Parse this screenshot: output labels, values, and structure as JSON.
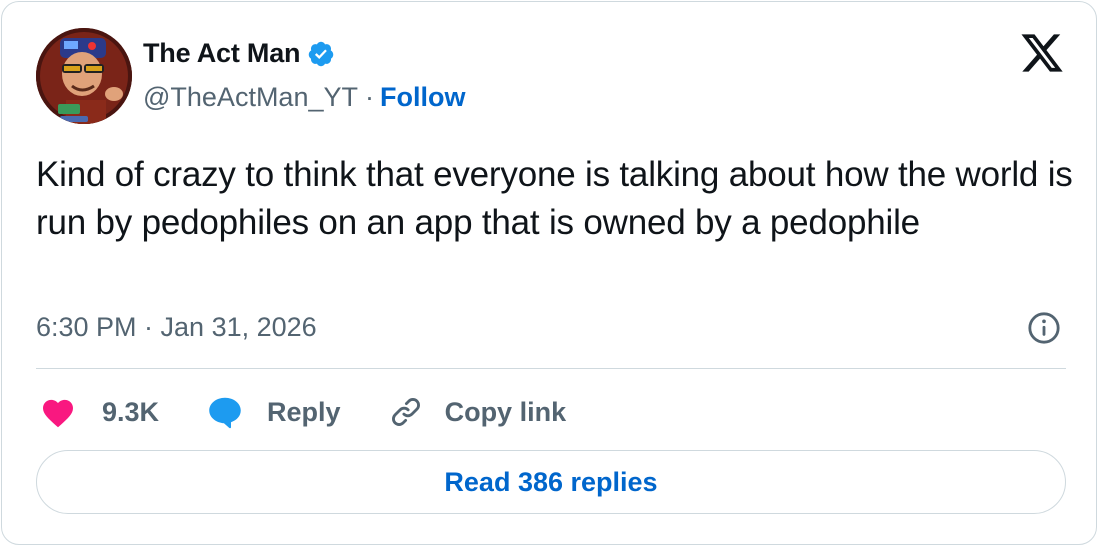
{
  "author": {
    "display_name": "The Act Man",
    "handle": "@TheActMan_YT",
    "separator": "·",
    "follow_label": "Follow",
    "verified": true
  },
  "tweet": {
    "text": "Kind of crazy to think that everyone is talking about how the world is run by pedophiles on an app that is owned by a pedophile",
    "timestamp": "6:30 PM · Jan 31, 2026"
  },
  "actions": {
    "like_count": "9.3K",
    "reply_label": "Reply",
    "copy_link_label": "Copy link"
  },
  "footer": {
    "read_replies_label": "Read 386 replies"
  },
  "colors": {
    "accent": "#0066cc",
    "verified_badge": "#1d9bf0",
    "like_heart": "#f91880",
    "reply_bubble": "#1d9bf0",
    "secondary_text": "#536471",
    "border": "#cfd9de"
  },
  "icons": [
    "verified-badge-icon",
    "x-logo-icon",
    "info-icon",
    "heart-icon",
    "reply-bubble-icon",
    "link-icon"
  ]
}
